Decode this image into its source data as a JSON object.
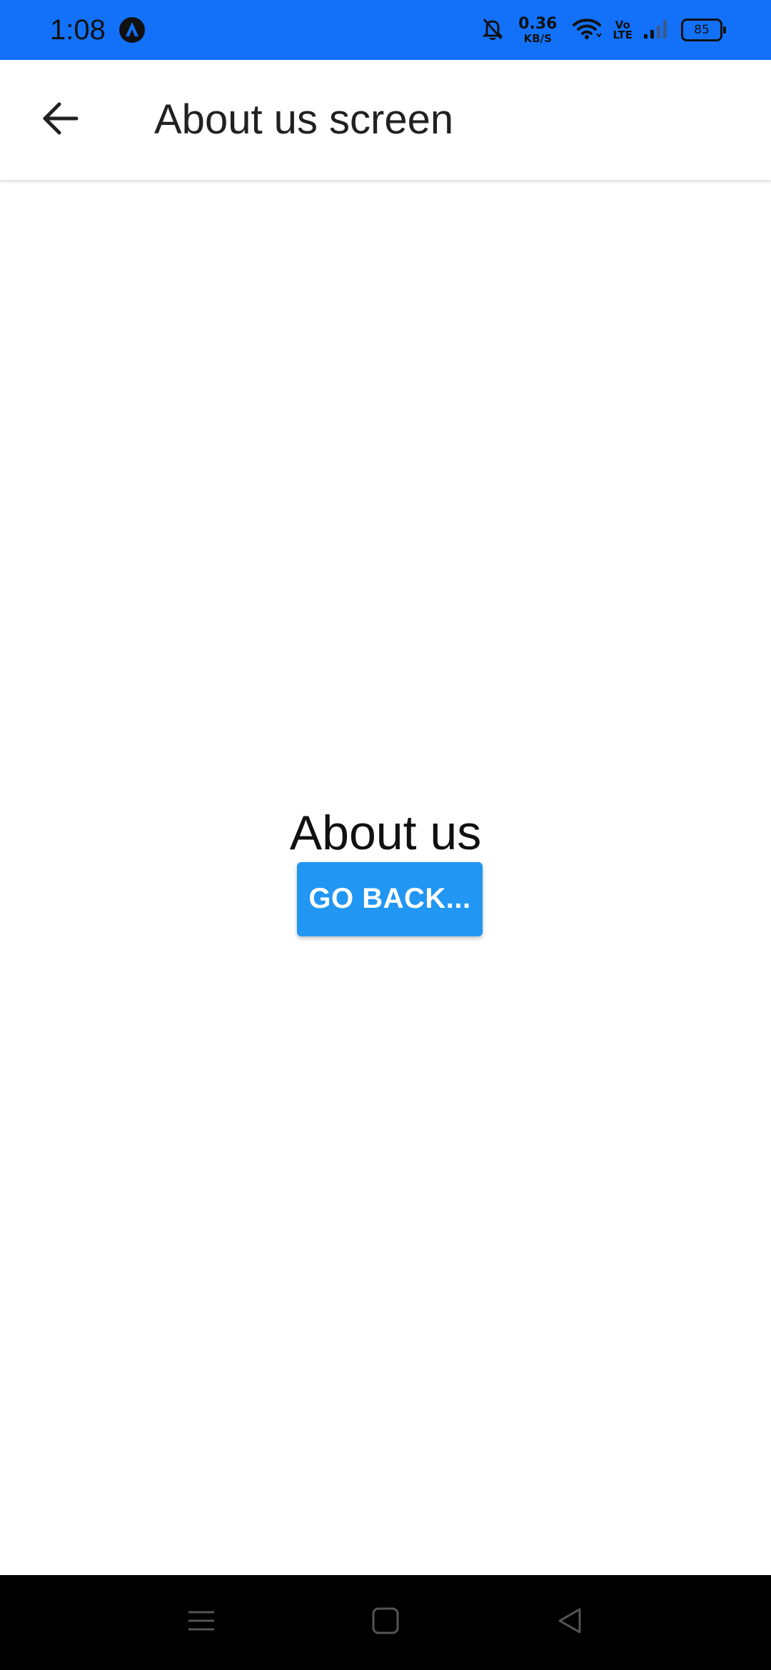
{
  "status_bar": {
    "time": "1:08",
    "net_speed_value": "0.36",
    "net_speed_unit": "KB/S",
    "volte_top": "Vo",
    "volte_bottom": "LTE",
    "battery_level": "85",
    "color": "#1271f8",
    "icons": [
      "app-notification-icon",
      "bell-off-icon",
      "wifi-icon",
      "signal-icon",
      "battery-icon"
    ]
  },
  "app_bar": {
    "title": "About us screen",
    "back_icon": "arrow-left-icon"
  },
  "main": {
    "heading": "About us",
    "go_back_label": "GO BACK...",
    "button_color": "#2196f3"
  },
  "nav_bar": {
    "icons": [
      "menu-icon",
      "home-icon",
      "back-triangle-icon"
    ]
  }
}
